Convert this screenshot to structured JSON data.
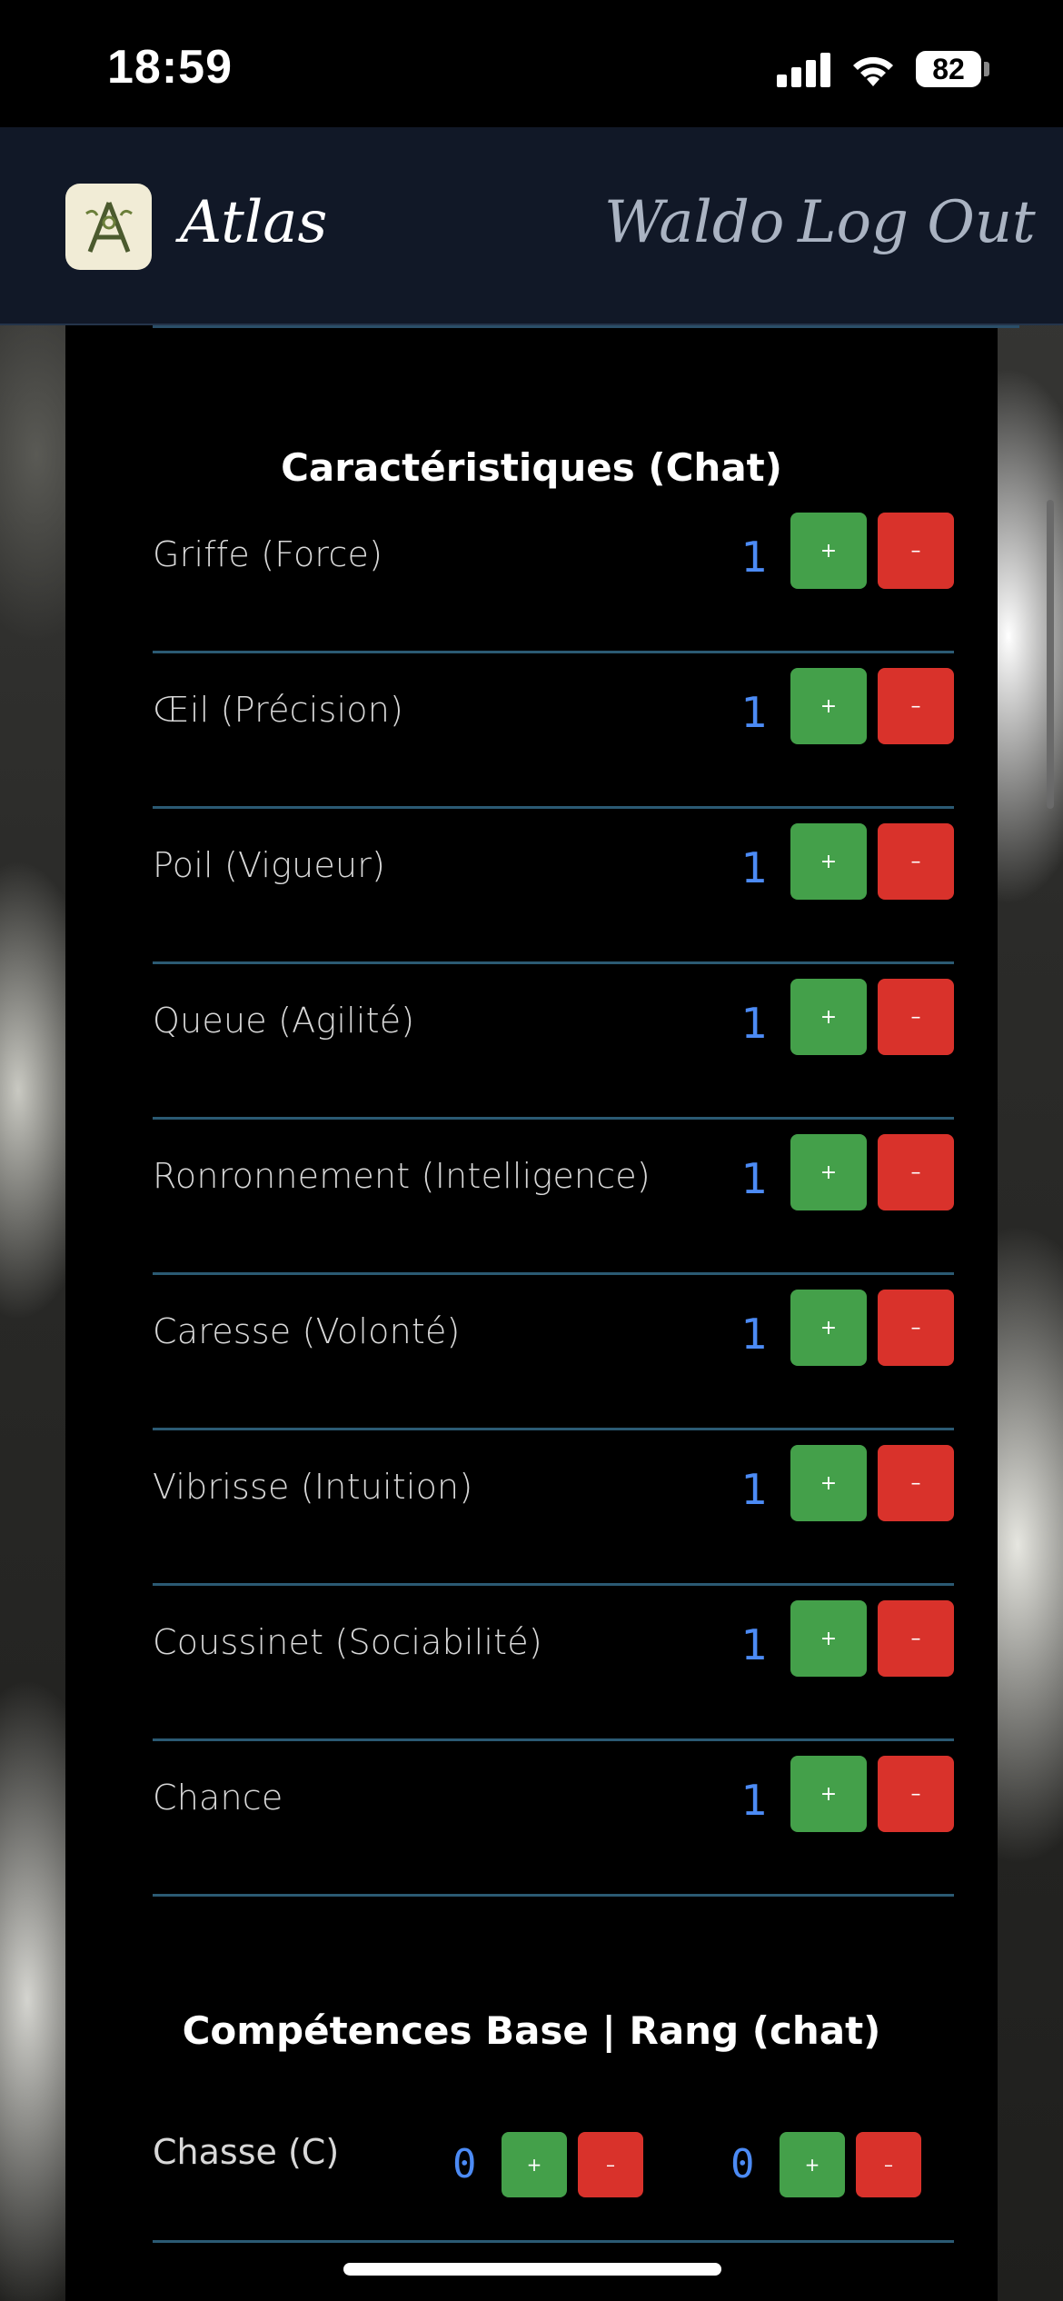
{
  "status_bar": {
    "time": "18:59",
    "battery": "82"
  },
  "header": {
    "brand": "Atlas",
    "user": "Waldo",
    "logout": "Log Out"
  },
  "characteristics": {
    "title": "Caractéristiques (Chat)",
    "rows": [
      {
        "label": "Griffe (Force)",
        "value": "1"
      },
      {
        "label": "Œil (Précision)",
        "value": "1"
      },
      {
        "label": "Poil (Vigueur)",
        "value": "1"
      },
      {
        "label": "Queue (Agilité)",
        "value": "1"
      },
      {
        "label": "Ronronnement (Intelligence)",
        "value": "1"
      },
      {
        "label": "Caresse (Volonté)",
        "value": "1"
      },
      {
        "label": "Vibrisse (Intuition)",
        "value": "1"
      },
      {
        "label": "Coussinet (Sociabilité)",
        "value": "1"
      },
      {
        "label": "Chance",
        "value": "1"
      }
    ],
    "plus_label": "+",
    "minus_label": "–"
  },
  "skills": {
    "title": "Compétences Base | Rang (chat)",
    "rows": [
      {
        "label": "Chasse (C)",
        "base": "0",
        "rank": "0"
      }
    ]
  },
  "colors": {
    "accent_value": "#4c8bf5",
    "plus": "#44a04a",
    "minus": "#d9322b",
    "divider": "#2b5a73"
  }
}
